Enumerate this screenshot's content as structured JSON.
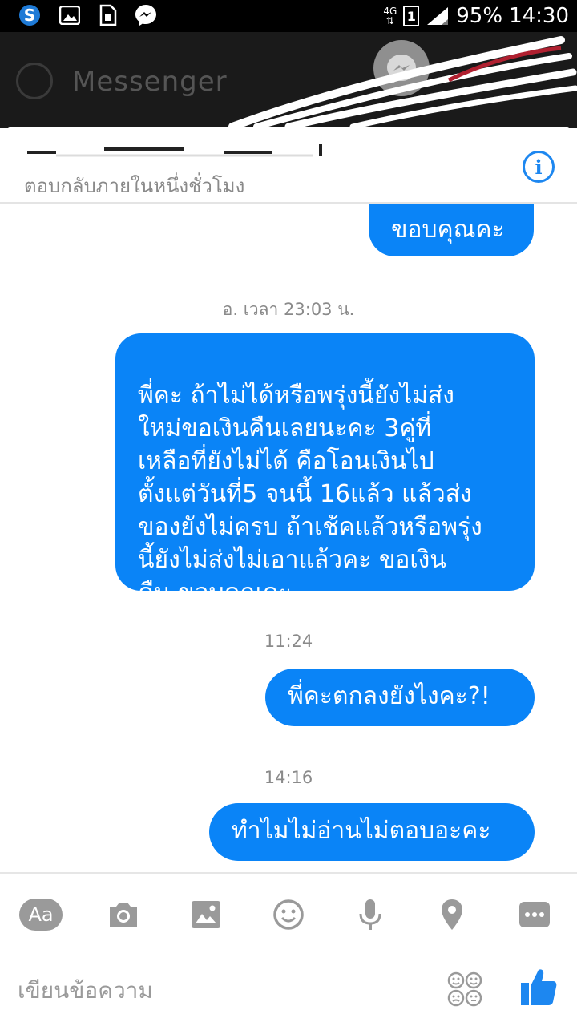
{
  "status_bar": {
    "network": "4G",
    "sim_slot": "1",
    "battery": "95%",
    "time": "14:30",
    "left_icons": [
      "skype-icon",
      "gallery-icon",
      "sim-card-icon",
      "messenger-icon"
    ]
  },
  "background_app": {
    "title": "Messenger"
  },
  "chat": {
    "contact_name": "",
    "contact_status": "ตอบกลับภายในหนึ่งชั่วโมง",
    "messages": [
      {
        "text": "ขอบคุณคะ"
      },
      {
        "stamp": "อ. เวลา 23:03 น."
      },
      {
        "text": "พี่คะ ถ้าไม่ได้หรือพรุ่งนี้ยังไม่ส่ง\nใหม่ขอเงินคืนเลยนะคะ 3คู่ที่\nเหลือที่ยังไม่ได้ คือโอนเงินไป\nตั้งแต่วันที่5 จนนี้ 16แล้ว แล้วส่ง\nของยังไม่ครบ ถ้าเช้คแล้วหรือพรุ่ง\nนี้ยังไม่ส่งไม่เอาแล้วคะ ขอเงิน\nคืน ขอบคุณคะ"
      },
      {
        "stamp": "11:24"
      },
      {
        "text": "พี่คะตกลงยังไงคะ?!"
      },
      {
        "stamp": "14:16"
      },
      {
        "text": "ทำไมไม่อ่านไม่ตอบอะคะ"
      }
    ]
  },
  "composer": {
    "aa_label": "Aa",
    "placeholder": "เขียนข้อความ",
    "tools": [
      "text-format-icon",
      "camera-icon",
      "image-icon",
      "emoji-icon",
      "microphone-icon",
      "location-icon",
      "more-icon"
    ]
  },
  "colors": {
    "accent": "#0a84f7",
    "icon_gray": "#9a9a9a",
    "like_blue": "#1d87f0"
  }
}
